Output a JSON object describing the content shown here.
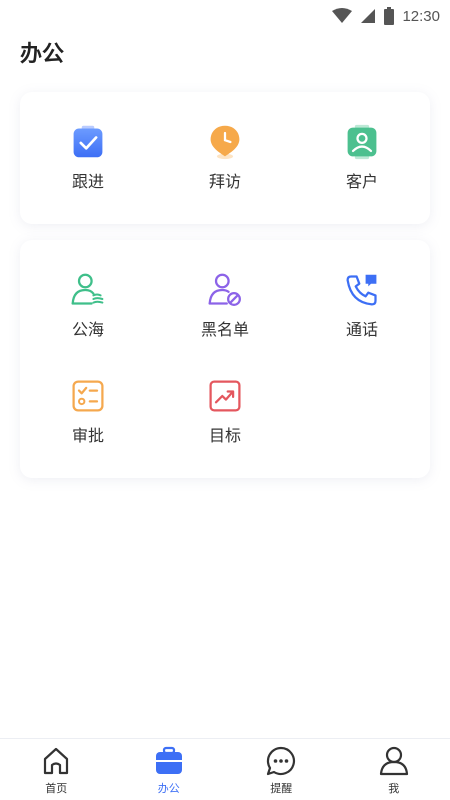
{
  "status_bar": {
    "time": "12:30",
    "icons": [
      "wifi-icon",
      "signal-icon",
      "battery-icon"
    ]
  },
  "page": {
    "title": "办公"
  },
  "cards": [
    {
      "items": [
        {
          "label": "跟进",
          "icon": "clipboard-check-icon"
        },
        {
          "label": "拜访",
          "icon": "location-clock-icon"
        },
        {
          "label": "客户",
          "icon": "contact-card-icon"
        }
      ]
    },
    {
      "items": [
        {
          "label": "公海",
          "icon": "user-pool-icon"
        },
        {
          "label": "黑名单",
          "icon": "user-block-icon"
        },
        {
          "label": "通话",
          "icon": "phone-message-icon"
        },
        {
          "label": "审批",
          "icon": "checklist-icon"
        },
        {
          "label": "目标",
          "icon": "trend-chart-icon"
        }
      ]
    }
  ],
  "bottom_nav": {
    "active": "办公",
    "items": [
      {
        "label": "首页",
        "icon": "home-icon"
      },
      {
        "label": "办公",
        "icon": "briefcase-icon"
      },
      {
        "label": "提醒",
        "icon": "chat-bubble-icon"
      },
      {
        "label": "我",
        "icon": "person-icon"
      }
    ]
  },
  "colors": {
    "accent": "#3d6ff5",
    "nav_text": "#333333",
    "title": "#222222"
  }
}
